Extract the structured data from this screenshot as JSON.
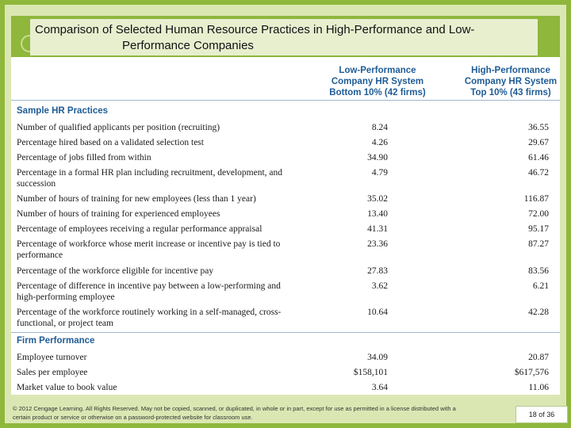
{
  "slide": {
    "title_line1": "Comparison of Selected Human Resource Practices in High-Performance and Low-",
    "title_line2": "Performance Companies"
  },
  "columns": {
    "low": [
      "Low-Performance",
      "Company HR System",
      "Bottom 10% (42 firms)"
    ],
    "high": [
      "High-Performance",
      "Company HR System",
      "Top 10% (43 firms)"
    ]
  },
  "sections": {
    "practices": "Sample HR Practices",
    "performance": "Firm Performance"
  },
  "practice_rows": [
    {
      "label": "Number of qualified applicants per position (recruiting)",
      "low": "8.24",
      "high": "36.55"
    },
    {
      "label": "Percentage hired based on a validated selection test",
      "low": "4.26",
      "high": "29.67"
    },
    {
      "label": "Percentage of jobs filled from within",
      "low": "34.90",
      "high": "61.46"
    },
    {
      "label": "Percentage in a formal HR plan including recruitment, development, and succession",
      "low": "4.79",
      "high": "46.72"
    },
    {
      "label": "Number of hours of training for new employees (less than 1 year)",
      "low": "35.02",
      "high": "116.87"
    },
    {
      "label": "Number of hours of training for experienced employees",
      "low": "13.40",
      "high": "72.00"
    },
    {
      "label": "Percentage of employees receiving a regular performance appraisal",
      "low": "41.31",
      "high": "95.17"
    },
    {
      "label": "Percentage of workforce whose merit increase or incentive pay is tied to performance",
      "low": "23.36",
      "high": "87.27"
    },
    {
      "label": "Percentage of the workforce eligible for incentive pay",
      "low": "27.83",
      "high": "83.56"
    },
    {
      "label": "Percentage of difference in incentive pay between a low-performing and high-performing employee",
      "low": "3.62",
      "high": "6.21"
    },
    {
      "label": "Percentage of the workforce routinely working in a self-managed, cross-functional, or project team",
      "low": "10.64",
      "high": "42.28"
    }
  ],
  "performance_rows": [
    {
      "label": "Employee turnover",
      "low": "34.09",
      "high": "20.87"
    },
    {
      "label": "Sales per employee",
      "low": "$158,101",
      "high": "$617,576"
    },
    {
      "label": "Market value to book value",
      "low": "3.64",
      "high": "11.06"
    }
  ],
  "footer": {
    "copyright": "© 2012 Cengage Learning. All Rights Reserved. May not be copied, scanned, or duplicated, in whole or in part, except for use as permitted in a license distributed with a certain product or service or otherwise on a password-protected website for classroom use.",
    "page": "18 of 36"
  },
  "colors": {
    "green": "#8fb73c",
    "header_blue": "#1f5c96"
  }
}
